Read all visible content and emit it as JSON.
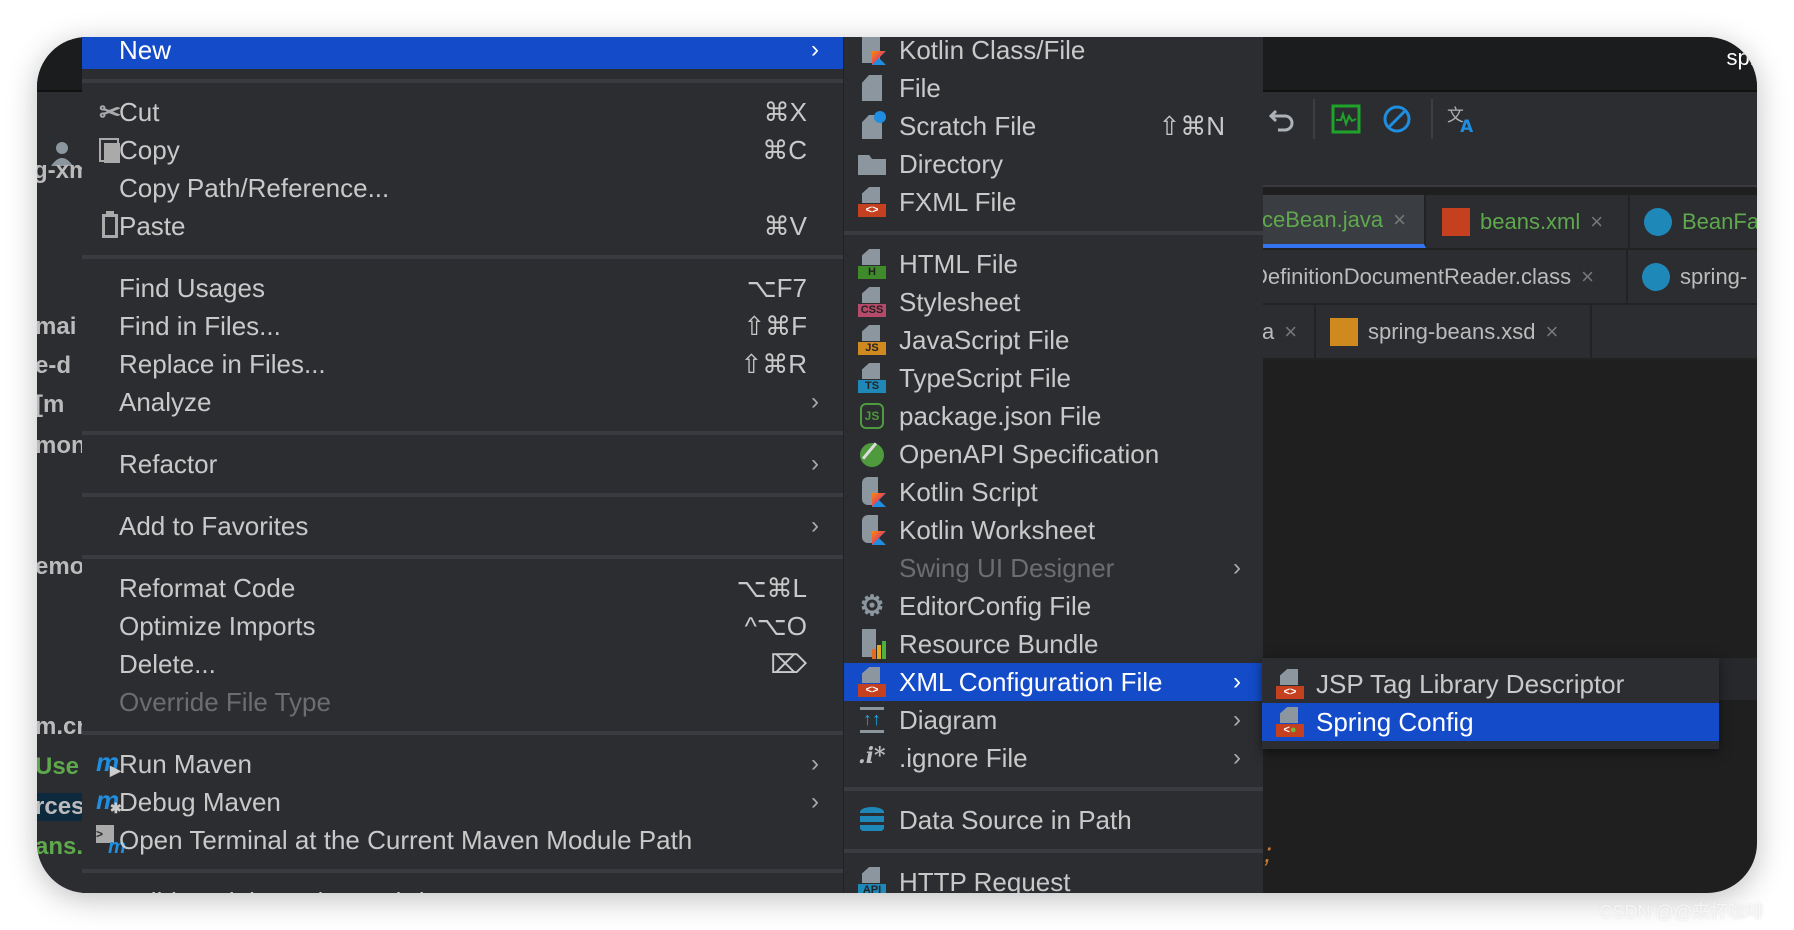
{
  "window": {
    "title": "spr"
  },
  "toolbar": {
    "icons": [
      "undo-icon",
      "activity-monitor-icon",
      "disable-icon",
      "translate-icon"
    ]
  },
  "sidebar": {
    "fragments": [
      "g-xm",
      "mai",
      "e-d",
      "[m",
      "mon",
      "emo",
      "m.cr",
      "Use",
      "rces",
      "ans."
    ]
  },
  "tabs": {
    "row1": [
      {
        "label": "ceBean.java",
        "active": true,
        "green": true,
        "icon": "java-class-icon"
      },
      {
        "label": "beans.xml",
        "green": true,
        "icon": "spring-xml-icon"
      },
      {
        "label": "BeanFa",
        "green": true,
        "icon": "class-icon"
      }
    ],
    "row2": [
      {
        "label": "DefinitionDocumentReader.class",
        "icon": ""
      },
      {
        "label": "spring-",
        "icon": "locked-class-icon"
      }
    ],
    "row3": [
      {
        "label": "a",
        "icon": ""
      },
      {
        "label": "spring-beans.xsd",
        "icon": "xsd-icon"
      }
    ],
    "close_glyph": "×"
  },
  "context_menu": {
    "items": [
      {
        "label": "New",
        "submenu": true,
        "selected": true
      },
      {
        "sep": true
      },
      {
        "label": "Cut",
        "shortcut": "⌘X",
        "icon": "scissors"
      },
      {
        "label": "Copy",
        "shortcut": "⌘C",
        "icon": "copy"
      },
      {
        "label": "Copy Path/Reference..."
      },
      {
        "label": "Paste",
        "shortcut": "⌘V",
        "icon": "paste"
      },
      {
        "sep": true
      },
      {
        "label": "Find Usages",
        "shortcut": "⌥F7"
      },
      {
        "label": "Find in Files...",
        "shortcut": "⇧⌘F"
      },
      {
        "label": "Replace in Files...",
        "shortcut": "⇧⌘R"
      },
      {
        "label": "Analyze",
        "submenu": true
      },
      {
        "sep": true
      },
      {
        "label": "Refactor",
        "submenu": true
      },
      {
        "sep": true
      },
      {
        "label": "Add to Favorites",
        "submenu": true
      },
      {
        "sep": true
      },
      {
        "label": "Reformat Code",
        "shortcut": "⌥⌘L"
      },
      {
        "label": "Optimize Imports",
        "shortcut": "^⌥O"
      },
      {
        "label": "Delete...",
        "shortcut": "⌦"
      },
      {
        "label": "Override File Type",
        "disabled": true
      },
      {
        "sep": true
      },
      {
        "label": "Run Maven",
        "submenu": true,
        "icon": "maven-run"
      },
      {
        "label": "Debug Maven",
        "submenu": true,
        "icon": "maven-debug"
      },
      {
        "label": "Open Terminal at the Current Maven Module Path",
        "icon": "maven-terminal"
      },
      {
        "sep": true
      },
      {
        "label": "Build Module 'spring-xml-demo'",
        "icon": ""
      }
    ]
  },
  "new_submenu": {
    "items": [
      {
        "label": "Kotlin Class/File",
        "icon": "kotlin"
      },
      {
        "label": "File",
        "icon": "file"
      },
      {
        "label": "Scratch File",
        "shortcut": "⇧⌘N",
        "icon": "scratch"
      },
      {
        "label": "Directory",
        "icon": "folder"
      },
      {
        "label": "FXML File",
        "icon": "xml"
      },
      {
        "sep": true
      },
      {
        "label": "HTML File",
        "icon": "html"
      },
      {
        "label": "Stylesheet",
        "icon": "css"
      },
      {
        "label": "JavaScript File",
        "icon": "js"
      },
      {
        "label": "TypeScript File",
        "icon": "ts"
      },
      {
        "label": "package.json File",
        "icon": "nodejs"
      },
      {
        "label": "OpenAPI Specification",
        "icon": "openapi"
      },
      {
        "label": "Kotlin Script",
        "icon": "kotlin-script"
      },
      {
        "label": "Kotlin Worksheet",
        "icon": "kotlin-script"
      },
      {
        "label": "Swing UI Designer",
        "submenu": true,
        "disabled": true
      },
      {
        "label": "EditorConfig File",
        "icon": "gear"
      },
      {
        "label": "Resource Bundle",
        "icon": "bundle"
      },
      {
        "label": "XML Configuration File",
        "submenu": true,
        "selected": true,
        "icon": "xml"
      },
      {
        "label": "Diagram",
        "submenu": true,
        "icon": "diagram"
      },
      {
        "label": ".ignore File",
        "submenu": true,
        "icon": "ignore"
      },
      {
        "sep": true
      },
      {
        "label": "Data Source in Path",
        "icon": "database"
      },
      {
        "sep": true
      },
      {
        "label": "HTTP Request",
        "icon": "api"
      }
    ]
  },
  "xml_submenu": {
    "items": [
      {
        "label": "JSP Tag Library Descriptor",
        "icon": "xml"
      },
      {
        "label": "Spring Config",
        "selected": true,
        "icon": "spring"
      }
    ]
  },
  "watermark": "CSDN @@来杯咖啡",
  "colors": {
    "selection": "#134bc8",
    "menu_bg": "#2b2d30",
    "accent_green": "#5fa84d",
    "tab_underline": "#3574f0"
  }
}
